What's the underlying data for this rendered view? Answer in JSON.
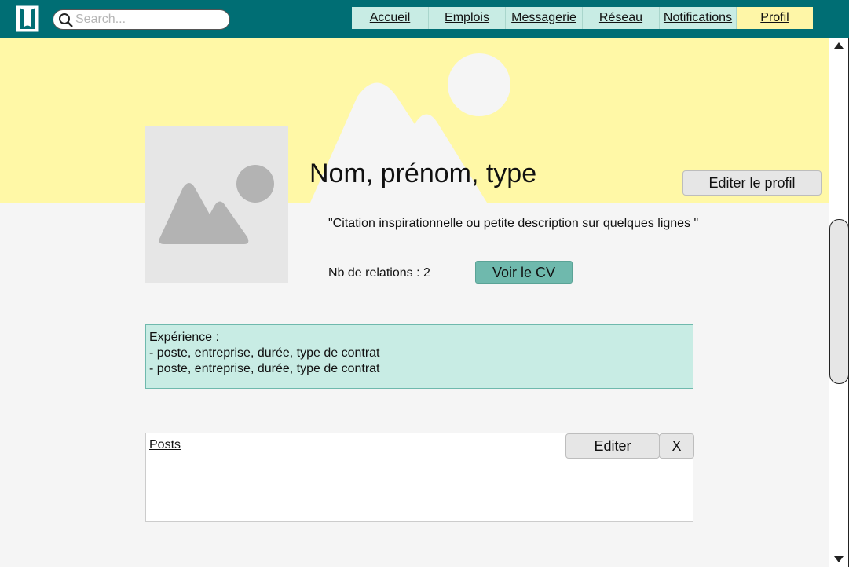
{
  "search": {
    "placeholder": "Search..."
  },
  "nav": {
    "items": [
      {
        "label": "Accueil"
      },
      {
        "label": "Emplois"
      },
      {
        "label": "Messagerie"
      },
      {
        "label": "Réseau"
      },
      {
        "label": "Notifications"
      },
      {
        "label": "Profil"
      }
    ],
    "active": "Profil"
  },
  "profile": {
    "name": "Nom, prénom, type",
    "edit_label": "Editer le profil",
    "quote": "\"Citation inspirationnelle ou petite description sur quelques lignes \"",
    "relations": "Nb de relations : 2",
    "cv_label": "Voir le CV"
  },
  "experience": {
    "title": "Expérience :",
    "items": [
      "- poste, entreprise, durée, type de contrat",
      "- poste, entreprise, durée, type de contrat"
    ]
  },
  "posts": {
    "title": "Posts",
    "edit_label": "Editer",
    "close_label": "X"
  },
  "colors": {
    "topbar": "#006e74",
    "banner": "#fff8a6",
    "nav_item": "#c8ece4",
    "nav_active": "#fef6a7",
    "cv_button": "#6fb9ad",
    "experience_bg": "#c8ece4"
  },
  "icons": [
    "logo-icon",
    "search-icon",
    "banner-image-placeholder-icon",
    "avatar-image-placeholder-icon",
    "scroll-up-icon",
    "scroll-down-icon"
  ]
}
